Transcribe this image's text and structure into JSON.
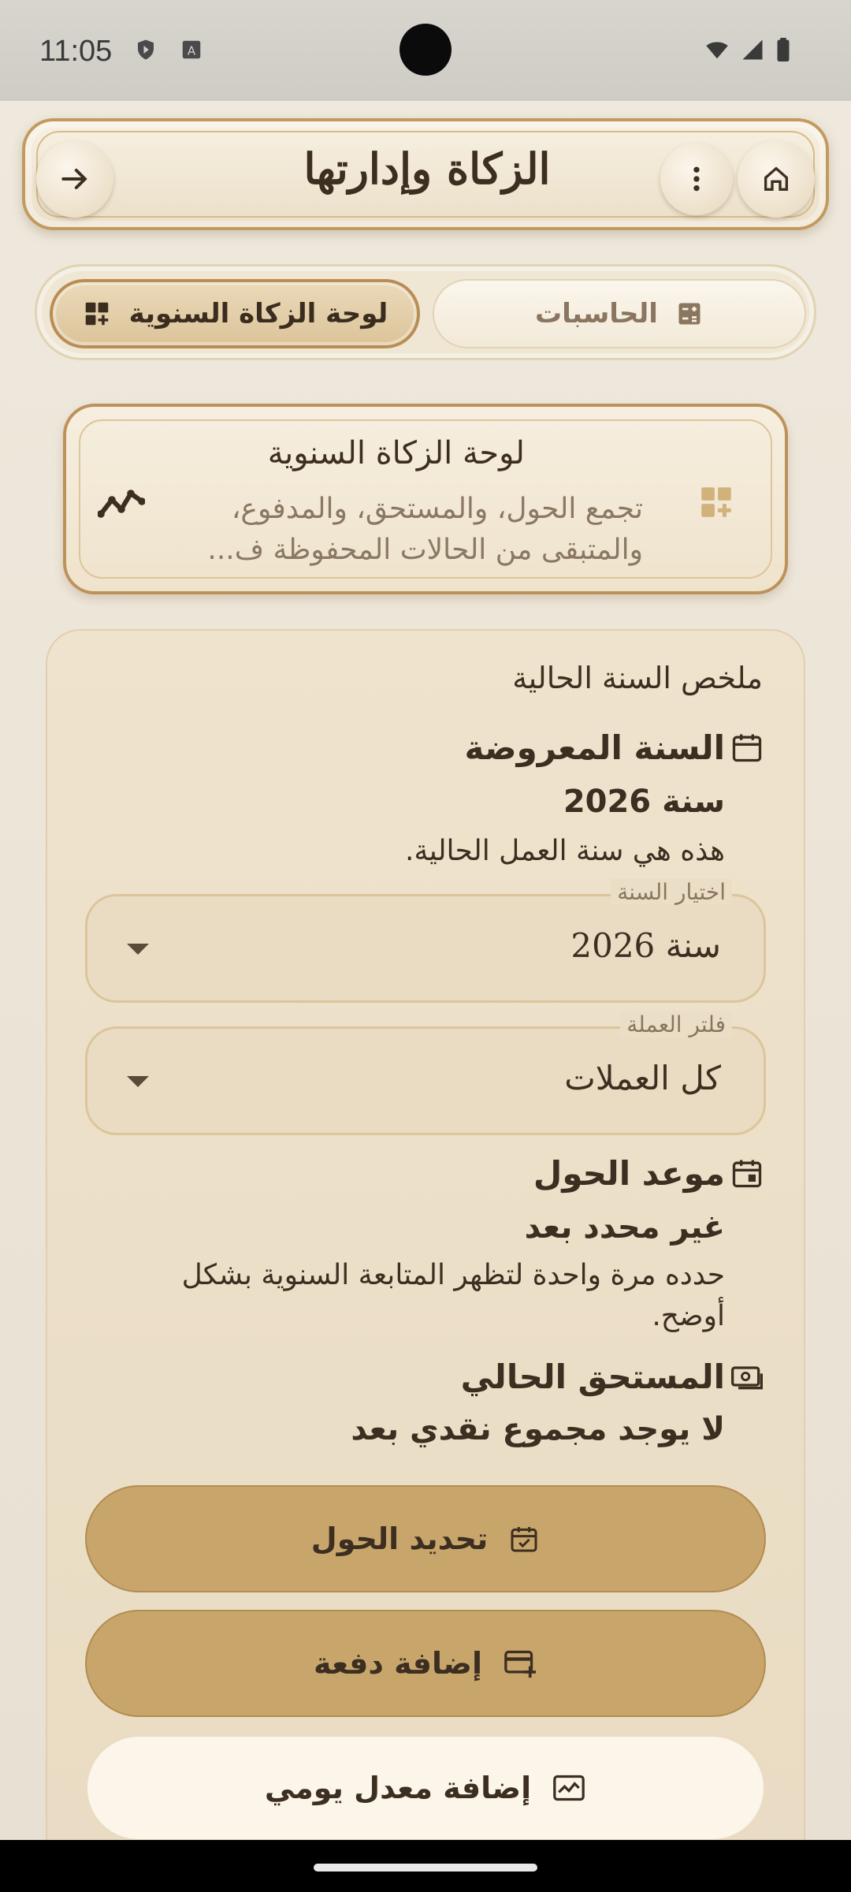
{
  "status": {
    "time": "11:05",
    "icons": [
      "shield-status-icon",
      "a-keyboard-icon",
      "wifi-icon",
      "signal-icon",
      "battery-icon"
    ]
  },
  "app_bar": {
    "title": "الزكاة وإدارتها",
    "back_icon": "arrow-right-icon",
    "menu_icon": "more-vert-icon",
    "home_icon": "home-icon"
  },
  "tabs": {
    "active": {
      "label": "لوحة الزكاة السنوية",
      "icon": "dashboard-add-icon"
    },
    "inactive": {
      "label": "الحاسبات",
      "icon": "calculator-icon"
    }
  },
  "info_card": {
    "title": "لوحة الزكاة السنوية",
    "description": "تجمع الحول، والمستحق، والمدفوع، والمتبقى من الحالات المحفوظة ف...",
    "trend_icon": "trend-line-icon",
    "dashboard_icon": "dashboard-add-icon"
  },
  "summary": {
    "section_label": "ملخص السنة الحالية",
    "displayed_year": {
      "title": "السنة المعروضة",
      "value": "سنة 2026",
      "sub": "هذه هي سنة العمل الحالية."
    },
    "year_select": {
      "label": "اختيار السنة",
      "value": "سنة 2026"
    },
    "currency_filter": {
      "label": "فلتر العملة",
      "value": "كل العملات"
    },
    "hawl_date": {
      "title": "موعد الحول",
      "value": "غير محدد بعد",
      "sub": "حدده مرة واحدة لتظهر المتابعة السنوية بشكل أوضح."
    },
    "current_due": {
      "title": "المستحق الحالي",
      "value": "لا يوجد مجموع نقدي بعد"
    }
  },
  "buttons": {
    "set_hawl": "تحديد الحول",
    "add_payment": "إضافة دفعة",
    "add_daily_rate": "إضافة معدل يومي"
  },
  "colors": {
    "accent": "#c8a56b",
    "border_gold": "#bd925a",
    "text_dark": "#3c2e20",
    "text_muted": "#8a7660"
  }
}
